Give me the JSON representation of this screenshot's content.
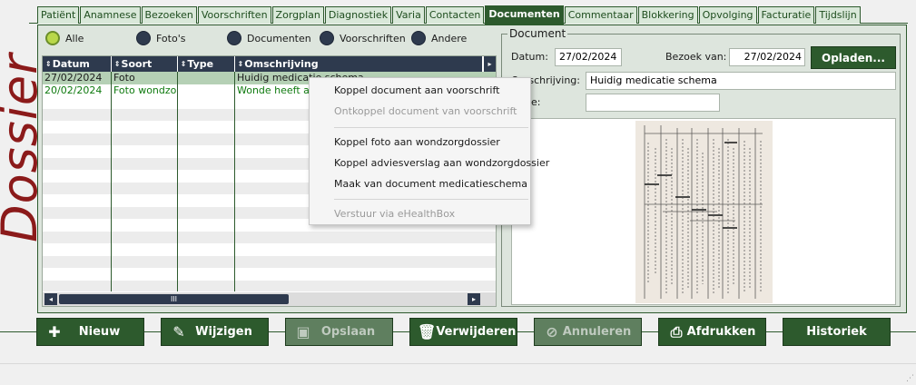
{
  "app_title": "Dossier",
  "tabs": [
    {
      "label": "Patiënt"
    },
    {
      "label": "Anamnese"
    },
    {
      "label": "Bezoeken"
    },
    {
      "label": "Voorschriften"
    },
    {
      "label": "Zorgplan"
    },
    {
      "label": "Diagnostiek"
    },
    {
      "label": "Varia"
    },
    {
      "label": "Contacten"
    },
    {
      "label": "Documenten",
      "active": true
    },
    {
      "label": "Commentaar"
    },
    {
      "label": "Blokkering"
    },
    {
      "label": "Opvolging"
    },
    {
      "label": "Facturatie"
    },
    {
      "label": "Tijdslijn"
    }
  ],
  "filters": [
    {
      "label": "Alle",
      "selected": true
    },
    {
      "label": "Foto's"
    },
    {
      "label": "Documenten"
    },
    {
      "label": "Voorschriften"
    },
    {
      "label": "Andere"
    }
  ],
  "grid": {
    "columns": [
      "Datum",
      "Soort",
      "Type",
      "Omschrijving"
    ],
    "rows": [
      {
        "datum": "27/02/2024",
        "soort": "Foto",
        "type": "",
        "omschrijving": "Huidig medicatie schema"
      },
      {
        "datum": "20/02/2024",
        "soort": "Foto wondzorg",
        "type": "",
        "omschrijving": "Wonde heeft a"
      }
    ],
    "scroll_grip": "III"
  },
  "document": {
    "legend": "Document",
    "datum_label": "Datum:",
    "datum_value": "27/02/2024",
    "bezoek_label": "Bezoek van:",
    "bezoek_value": "27/02/2024",
    "upload_label": "Opladen...",
    "omschrijving_label": "Omschrijving:",
    "omschrijving_value": "Huidig medicatie schema",
    "extra_label": "e:",
    "extra_value": ""
  },
  "context_menu": {
    "items": [
      {
        "label": "Koppel document aan voorschrift",
        "enabled": true
      },
      {
        "label": "Ontkoppel document van voorschrift",
        "enabled": false
      },
      {
        "label": "Koppel foto aan wondzorgdossier",
        "enabled": true
      },
      {
        "label": "Koppel adviesverslag aan wondzorgdossier",
        "enabled": true
      },
      {
        "label": "Maak van document medicatieschema",
        "enabled": true
      },
      {
        "label": "Verstuur via eHealthBox",
        "enabled": false
      }
    ]
  },
  "buttons": {
    "nieuw": "Nieuw",
    "wijzigen": "Wijzigen",
    "opslaan": "Opslaan",
    "verwijderen": "Verwijderen",
    "annuleren": "Annuleren",
    "afdrukken": "Afdrukken",
    "historiek": "Historiek"
  },
  "icons": {
    "nieuw": "plus-icon",
    "wijzigen": "pencil-icon",
    "opslaan": "floppy-icon",
    "verwijderen": "trash-icon",
    "annuleren": "cancel-icon",
    "afdrukken": "printer-icon"
  },
  "colors": {
    "brand_green": "#2d5a2d",
    "title_red": "#8b1a1a",
    "header_navy": "#2e3a4e",
    "row_green_text": "#0f7a0f"
  }
}
